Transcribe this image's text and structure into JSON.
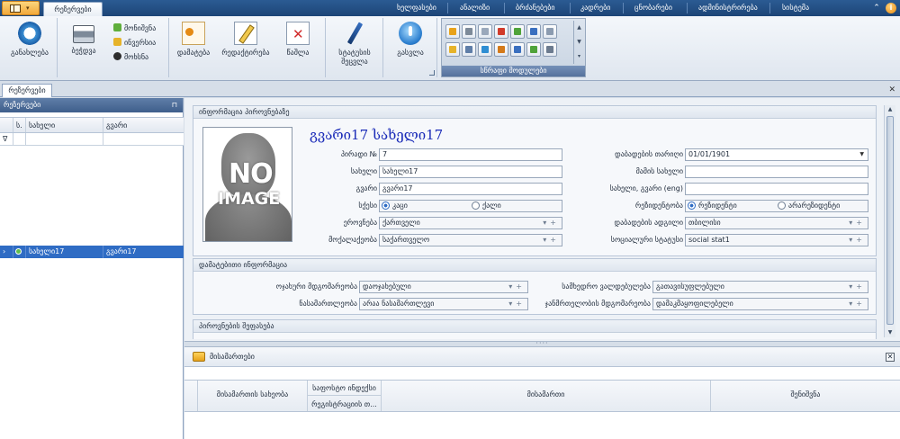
{
  "menubar": {
    "active_tab": "რეზერვები",
    "menus": [
      "ხელფასები",
      "ანალიზი",
      "ბრძანებები",
      "კადრები",
      "ცნობარები",
      "ადმინისტრირება",
      "სისტემა"
    ]
  },
  "ribbon": {
    "refresh": "განახლება",
    "print": "ბეჭდვა",
    "filter_small": [
      "მონიშვნა",
      "ინვერსია",
      "მოხსნა"
    ],
    "add": "დამატება",
    "edit": "რედაქტირება",
    "delete": "წაშლა",
    "status_change": "სტატუსის შეცვლა",
    "exit": "გასვლა",
    "quick_panel_label": "სწრაფი მოდულები"
  },
  "doc_tab": {
    "label": "რეზერვები"
  },
  "left_panel": {
    "title": "რეზერვები",
    "columns": [
      "ს.",
      "სახელი",
      "გვარი"
    ],
    "rows": [
      {
        "name": "სახელი17",
        "surname": "გვარი17"
      }
    ]
  },
  "person": {
    "section_title": "ინფორმაცია პიროვნებაზე",
    "photo_text_1": "NO",
    "photo_text_2": "IMAGE",
    "full_name": "გვარი17 სახელი17",
    "labels": {
      "personal_no": "პირადი №",
      "first_name": "სახელი",
      "last_name": "გვარი",
      "gender": "სქესი",
      "nationality": "ეროვნება",
      "citizenship": "მოქალაქეობა",
      "birth_date": "დაბადების თარიღი",
      "father_name": "მამის სახელი",
      "name_eng": "სახელი, გვარი (eng)",
      "residency": "რეზიდენტობა",
      "birth_place": "დაბადების ადგილი",
      "social_status": "სოციალური სტატუსი"
    },
    "values": {
      "personal_no": "7",
      "first_name": "სახელი17",
      "last_name": "გვარი17",
      "nationality": "ქართველი",
      "citizenship": "საქართველო",
      "birth_date": "01/01/1901",
      "father_name": "",
      "name_eng": "",
      "birth_place": "თბილისი",
      "social_status": "social stat1"
    },
    "gender_options": [
      "კაცი",
      "ქალი"
    ],
    "residency_options": [
      "რეზიდენტი",
      "არარეზიდენტი"
    ]
  },
  "additional": {
    "section_title": "დამატებითი ინფორმაცია",
    "labels": {
      "family_status": "ოჯახური მდგომარეობა",
      "conviction": "ნასამართლეობა",
      "military": "სამხედრო ვალდებულება",
      "health": "ჯანმრთელობის მდგომარეობა"
    },
    "values": {
      "family_status": "დაოჯახებული",
      "conviction": "არაა ნასამართლევი",
      "military": "გათავისუფლებული",
      "health": "დამაკმაყოფილებელი"
    }
  },
  "evaluation": {
    "section_title": "პიროვნების შეფასება"
  },
  "addresses": {
    "title": "მისამართები",
    "columns": {
      "address_type": "მისამართის სახეობა",
      "postal_index": "საფოსტო ინდექსი",
      "registration": "რეგისტრაციის თ...",
      "address": "მისამართი",
      "note": "შენიშვნა"
    }
  }
}
